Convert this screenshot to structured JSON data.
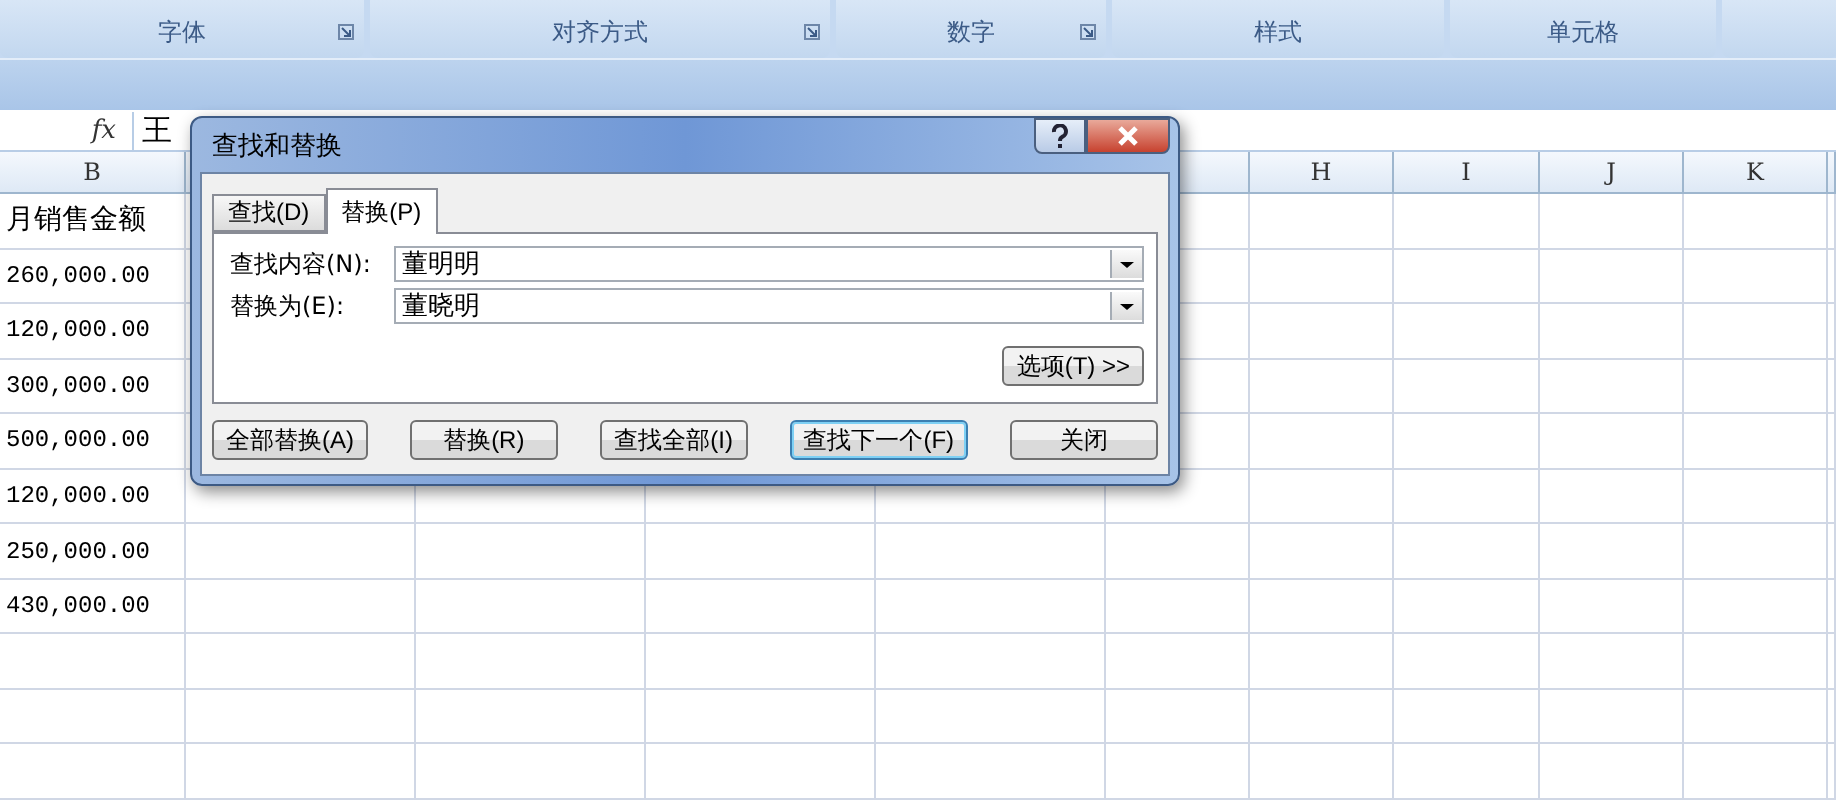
{
  "ribbon": {
    "groups": [
      {
        "label": "字体",
        "launcher": true
      },
      {
        "label": "对齐方式",
        "launcher": true
      },
      {
        "label": "数字",
        "launcher": true
      },
      {
        "label": "样式",
        "launcher": false
      },
      {
        "label": "单元格",
        "launcher": false
      }
    ]
  },
  "formula_bar": {
    "function_label": "fx",
    "value": "王"
  },
  "sheet": {
    "column_headers": [
      {
        "label": "B"
      },
      {
        "label": "H"
      },
      {
        "label": "I"
      },
      {
        "label": "J"
      },
      {
        "label": "K"
      }
    ],
    "column_b": [
      "月销售金额",
      "260,000.00",
      "120,000.00",
      "300,000.00",
      "500,000.00",
      "120,000.00",
      "250,000.00",
      "430,000.00"
    ]
  },
  "dialog": {
    "title": "查找和替换",
    "tabs": [
      {
        "label": "查找(D)",
        "selected": false
      },
      {
        "label": "替换(P)",
        "selected": true
      }
    ],
    "fields": [
      {
        "label": "查找内容(N):",
        "value": "董明明"
      },
      {
        "label": "替换为(E):",
        "value": "董晓明"
      }
    ],
    "options_button": "选项(T) >>",
    "buttons": [
      {
        "label": "全部替换(A)",
        "focused": false
      },
      {
        "label": "替换(R)",
        "focused": false
      },
      {
        "label": "查找全部(I)",
        "focused": false
      },
      {
        "label": "查找下一个(F)",
        "focused": true
      },
      {
        "label": "关闭",
        "focused": false
      }
    ]
  }
}
